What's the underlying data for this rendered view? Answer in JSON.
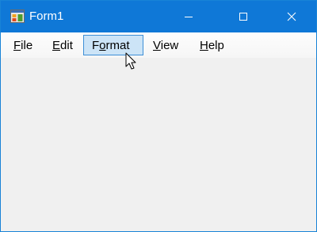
{
  "window": {
    "title": "Form1",
    "app_icon": "form-app-icon",
    "controls": {
      "minimize_icon": "minimize-icon",
      "maximize_icon": "maximize-icon",
      "close_icon": "close-icon"
    }
  },
  "menubar": {
    "items": [
      {
        "accel": "F",
        "rest": "ile"
      },
      {
        "accel": "E",
        "rest": "dit"
      },
      {
        "pre": "F",
        "accel": "o",
        "rest": "rmat",
        "selected": true
      },
      {
        "accel": "V",
        "rest": "iew"
      },
      {
        "accel": "H",
        "rest": "elp"
      }
    ]
  },
  "cursor": "arrow-cursor-icon",
  "colors": {
    "titlebar": "#0f78d7",
    "client": "#f0f0f0",
    "menu_selected_bg": "#cce4f7",
    "menu_selected_border": "#3d8fd7"
  }
}
